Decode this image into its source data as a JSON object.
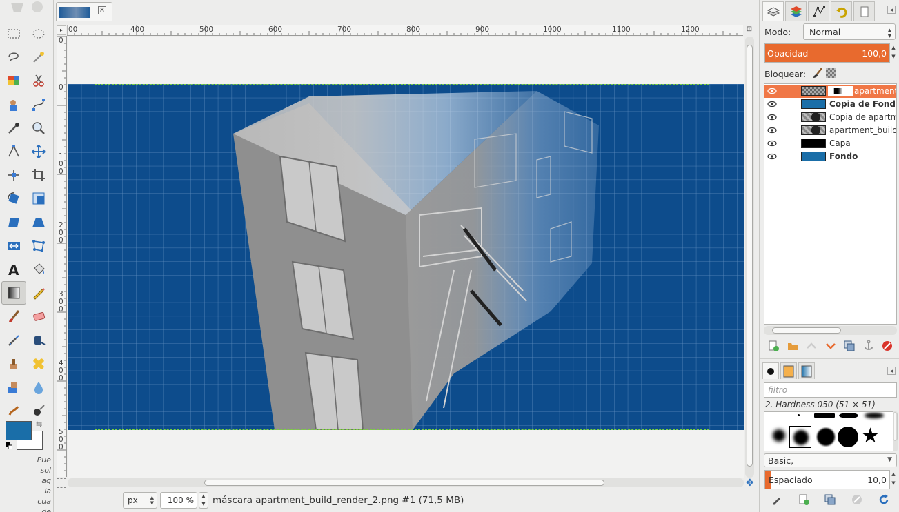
{
  "image_window": {
    "tab_close": "×",
    "ruler_h_labels": [
      "00",
      "400",
      "500",
      "600",
      "700",
      "800",
      "900",
      "1000",
      "1100",
      "1200"
    ],
    "ruler_v_labels": [
      "0",
      "0",
      "1\n0\n0",
      "2\n0\n0",
      "3\n0\n0",
      "4\n0\n0",
      "5\n0\n0"
    ],
    "status": {
      "unit": "px",
      "zoom": "100 %",
      "title": "máscara apartment_build_render_2.png #1 (71,5 MB)"
    }
  },
  "toolbox": {
    "hint_text": "Pue\nsol\naq\nla\ncua\nde"
  },
  "layers_panel": {
    "mode_label": "Modo:",
    "mode_value": "Normal",
    "opacity_label": "Opacidad",
    "opacity_value": "100,0",
    "lock_label": "Bloquear:",
    "layers": [
      {
        "name": "apartment",
        "bold": false,
        "selected": true,
        "has_mask": true
      },
      {
        "name": "Copia de Fondo",
        "bold": true,
        "selected": false,
        "has_mask": false
      },
      {
        "name": "Copia de apartme",
        "bold": false,
        "selected": false,
        "has_mask": false
      },
      {
        "name": "apartment_build_",
        "bold": false,
        "selected": false,
        "has_mask": false
      },
      {
        "name": "Capa",
        "bold": false,
        "selected": false,
        "has_mask": false
      },
      {
        "name": "Fondo",
        "bold": true,
        "selected": false,
        "has_mask": false
      }
    ]
  },
  "brushes_panel": {
    "filter_placeholder": "filtro",
    "brush_name": "2. Hardness 050 (51 × 51)",
    "brush_set": "Basic,",
    "spacing_label": "Espaciado",
    "spacing_value": "10,0"
  },
  "colors": {
    "foreground": "#1a6ea8",
    "background": "#ffffff",
    "accent": "#f07746",
    "canvas_blue": "#0d4c8c"
  }
}
